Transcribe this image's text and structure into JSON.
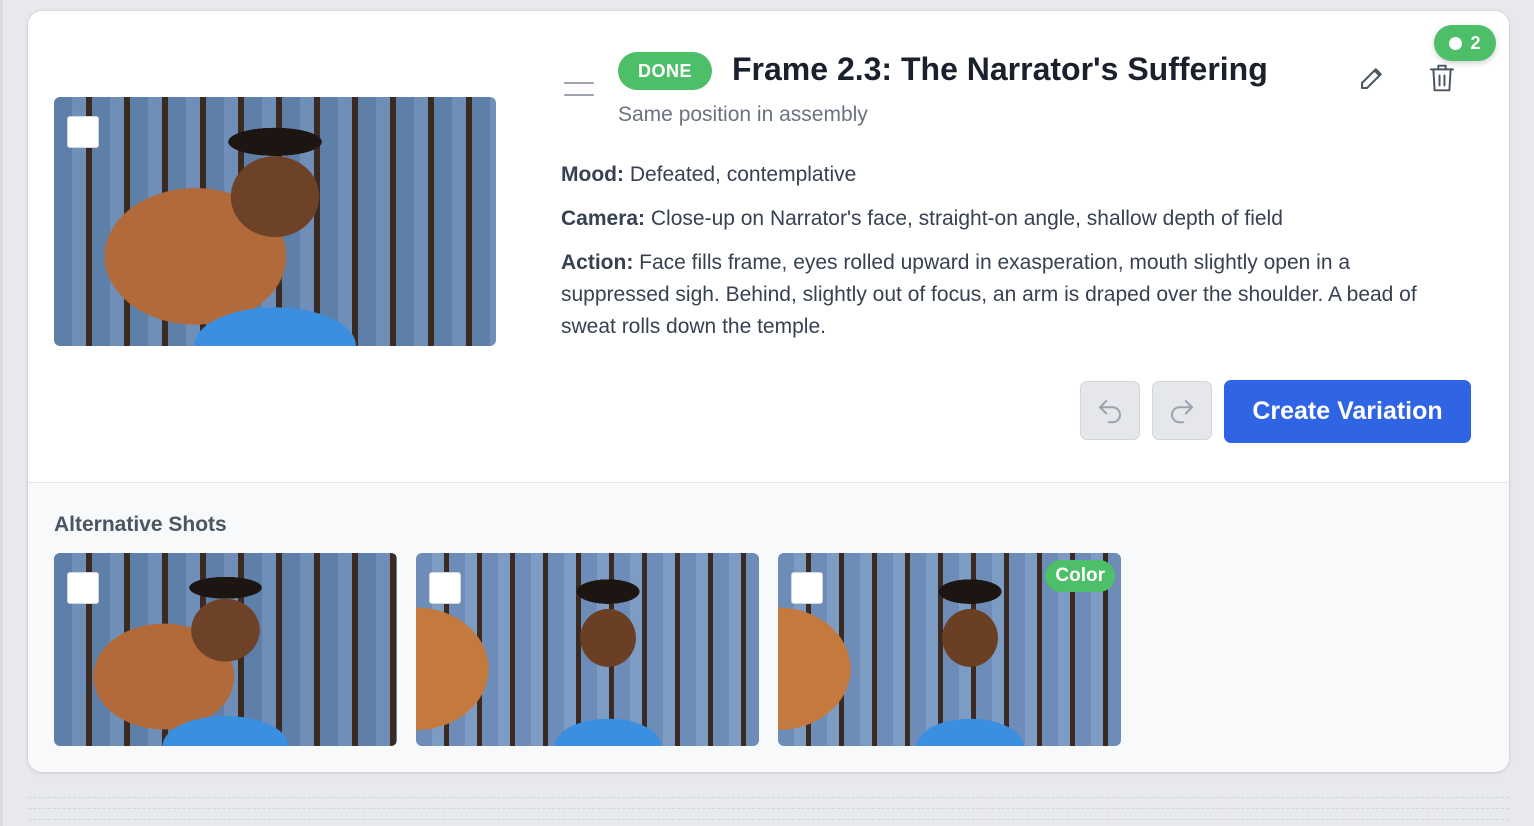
{
  "frame": {
    "status": "DONE",
    "title": "Frame 2.3: The Narrator's Suffering",
    "subtitle": "Same position in assembly",
    "count": "2",
    "mood_label": "Mood:",
    "mood": " Defeated, contemplative",
    "camera_label": "Camera:",
    "camera": " Close-up on Narrator's face, straight-on angle, shallow depth of field",
    "action_label": "Action:",
    "action": " Face fills frame, eyes rolled upward in exasperation, mouth slightly open in a suppressed sigh. Behind, slightly out of focus, an arm is draped over the shoulder. A bead of sweat rolls down the temple."
  },
  "actions": {
    "create_variation": "Create Variation"
  },
  "alternatives": {
    "heading": "Alternative Shots",
    "items": [
      {
        "badge": ""
      },
      {
        "badge": ""
      },
      {
        "badge": "Color"
      }
    ]
  },
  "colors": {
    "accent": "#2f64e4",
    "status_green": "#4dbf69"
  },
  "icons": [
    "drag-handle-icon",
    "edit-icon",
    "trash-icon",
    "undo-icon",
    "redo-icon"
  ]
}
